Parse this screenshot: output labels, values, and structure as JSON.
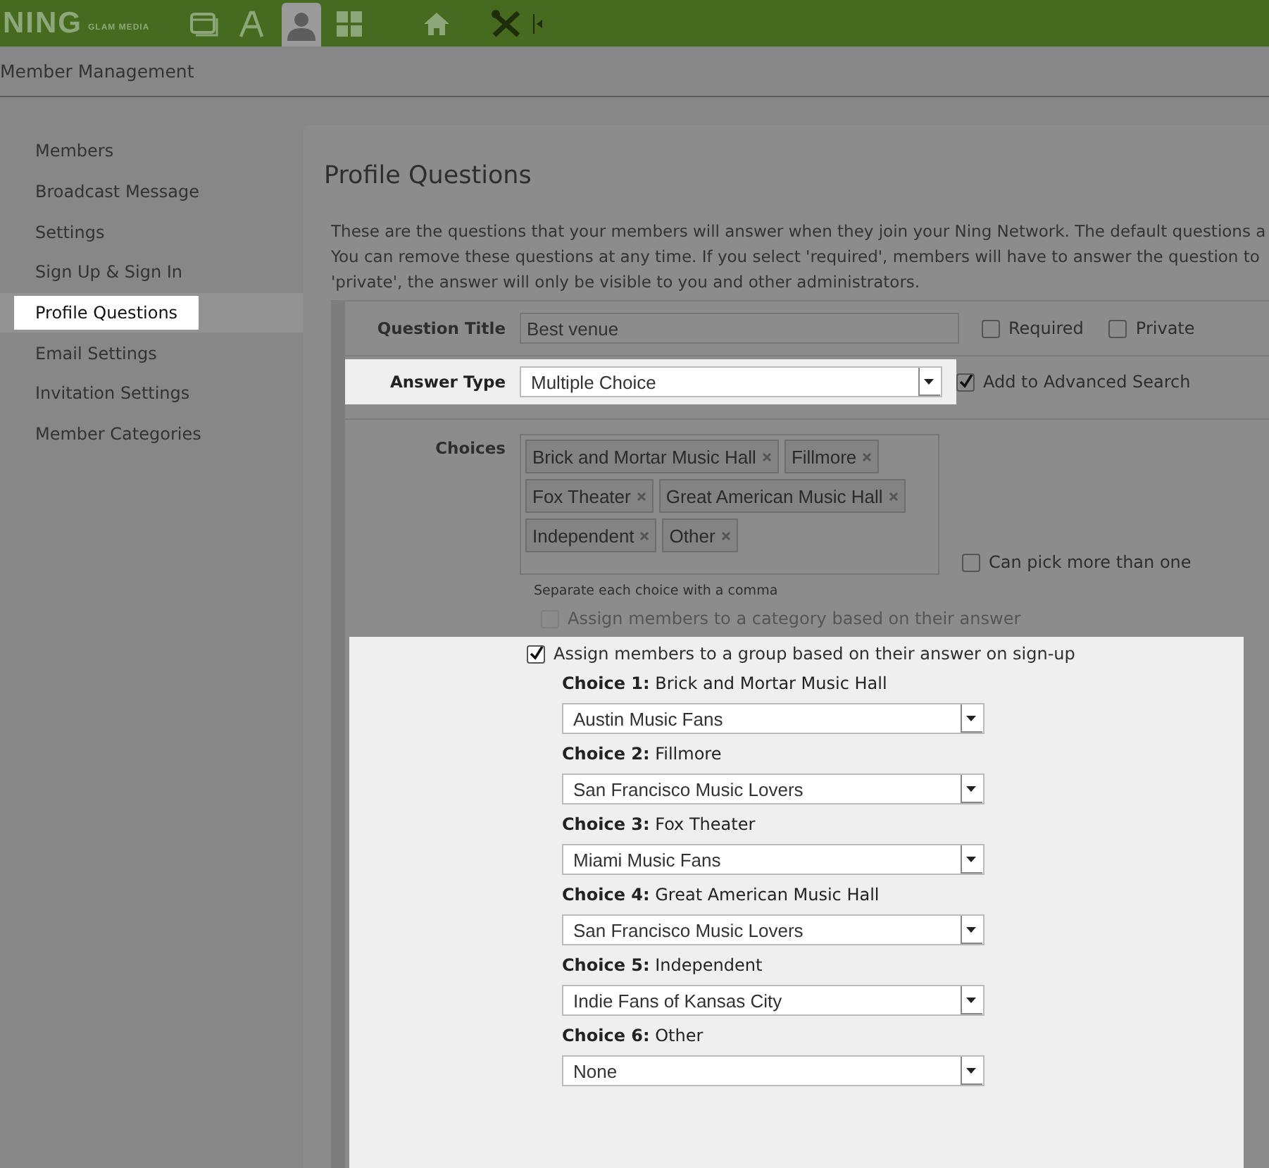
{
  "topbar": {
    "logo": "NING",
    "logo_sub": "GLAM MEDIA",
    "nav": [
      {
        "selected": false
      },
      {
        "selected": false
      },
      {
        "selected": true
      },
      {
        "selected": false
      },
      {
        "selected": false
      },
      {
        "selected": false
      }
    ]
  },
  "page_title": "Member Management",
  "sidebar": {
    "items": [
      {
        "label": "Members",
        "selected": false
      },
      {
        "label": "Broadcast Message",
        "selected": false
      },
      {
        "label": "Settings",
        "selected": false
      },
      {
        "label": "Sign Up & Sign In",
        "selected": false
      },
      {
        "label": "Profile Questions",
        "selected": true
      },
      {
        "label": "Email Settings",
        "selected": false
      },
      {
        "label": "Invitation Settings",
        "selected": false
      },
      {
        "label": "Member Categories",
        "selected": false
      }
    ]
  },
  "main": {
    "title": "Profile Questions",
    "intro": [
      "These are the questions that your members will answer when they join your Ning Network. The default questions a",
      "You can remove these questions at any time. If you select 'required', members will have to answer the question to",
      "'private', the answer will only be visible to you and other administrators."
    ],
    "question_title": {
      "label": "Question Title",
      "value": "Best venue",
      "options": [
        {
          "label": "Required",
          "checked": false
        },
        {
          "label": "Private",
          "checked": false
        }
      ]
    },
    "answer_type": {
      "label": "Answer Type",
      "value": "Multiple Choice",
      "highlighted": true,
      "option": {
        "label": "Add to Advanced Search",
        "checked": true
      }
    },
    "choices": {
      "label": "Choices",
      "tags": [
        "Brick and Mortar Music Hall",
        "Fillmore",
        "Fox Theater",
        "Great American Music Hall",
        "Independent",
        "Other"
      ],
      "hint": "Separate each choice with a comma",
      "option": {
        "label": "Can pick more than one",
        "checked": false
      }
    },
    "category_option": {
      "label": "Assign members to a category based on their answer",
      "checked": false,
      "disabled": true
    },
    "group_section": {
      "highlighted": true,
      "option": {
        "label": "Assign members to a group based on their answer on sign-up",
        "checked": true
      },
      "mappings": [
        {
          "label": "Choice 1:",
          "choice": "Brick and Mortar Music Hall",
          "group": "Austin Music Fans"
        },
        {
          "label": "Choice 2:",
          "choice": "Fillmore",
          "group": "San Francisco Music Lovers"
        },
        {
          "label": "Choice 3:",
          "choice": "Fox Theater",
          "group": "Miami Music Fans"
        },
        {
          "label": "Choice 4:",
          "choice": "Great American Music Hall",
          "group": "San Francisco Music Lovers"
        },
        {
          "label": "Choice 5:",
          "choice": "Independent",
          "group": "Indie Fans of Kansas City"
        },
        {
          "label": "Choice 6:",
          "choice": "Other",
          "group": "None"
        }
      ]
    }
  }
}
